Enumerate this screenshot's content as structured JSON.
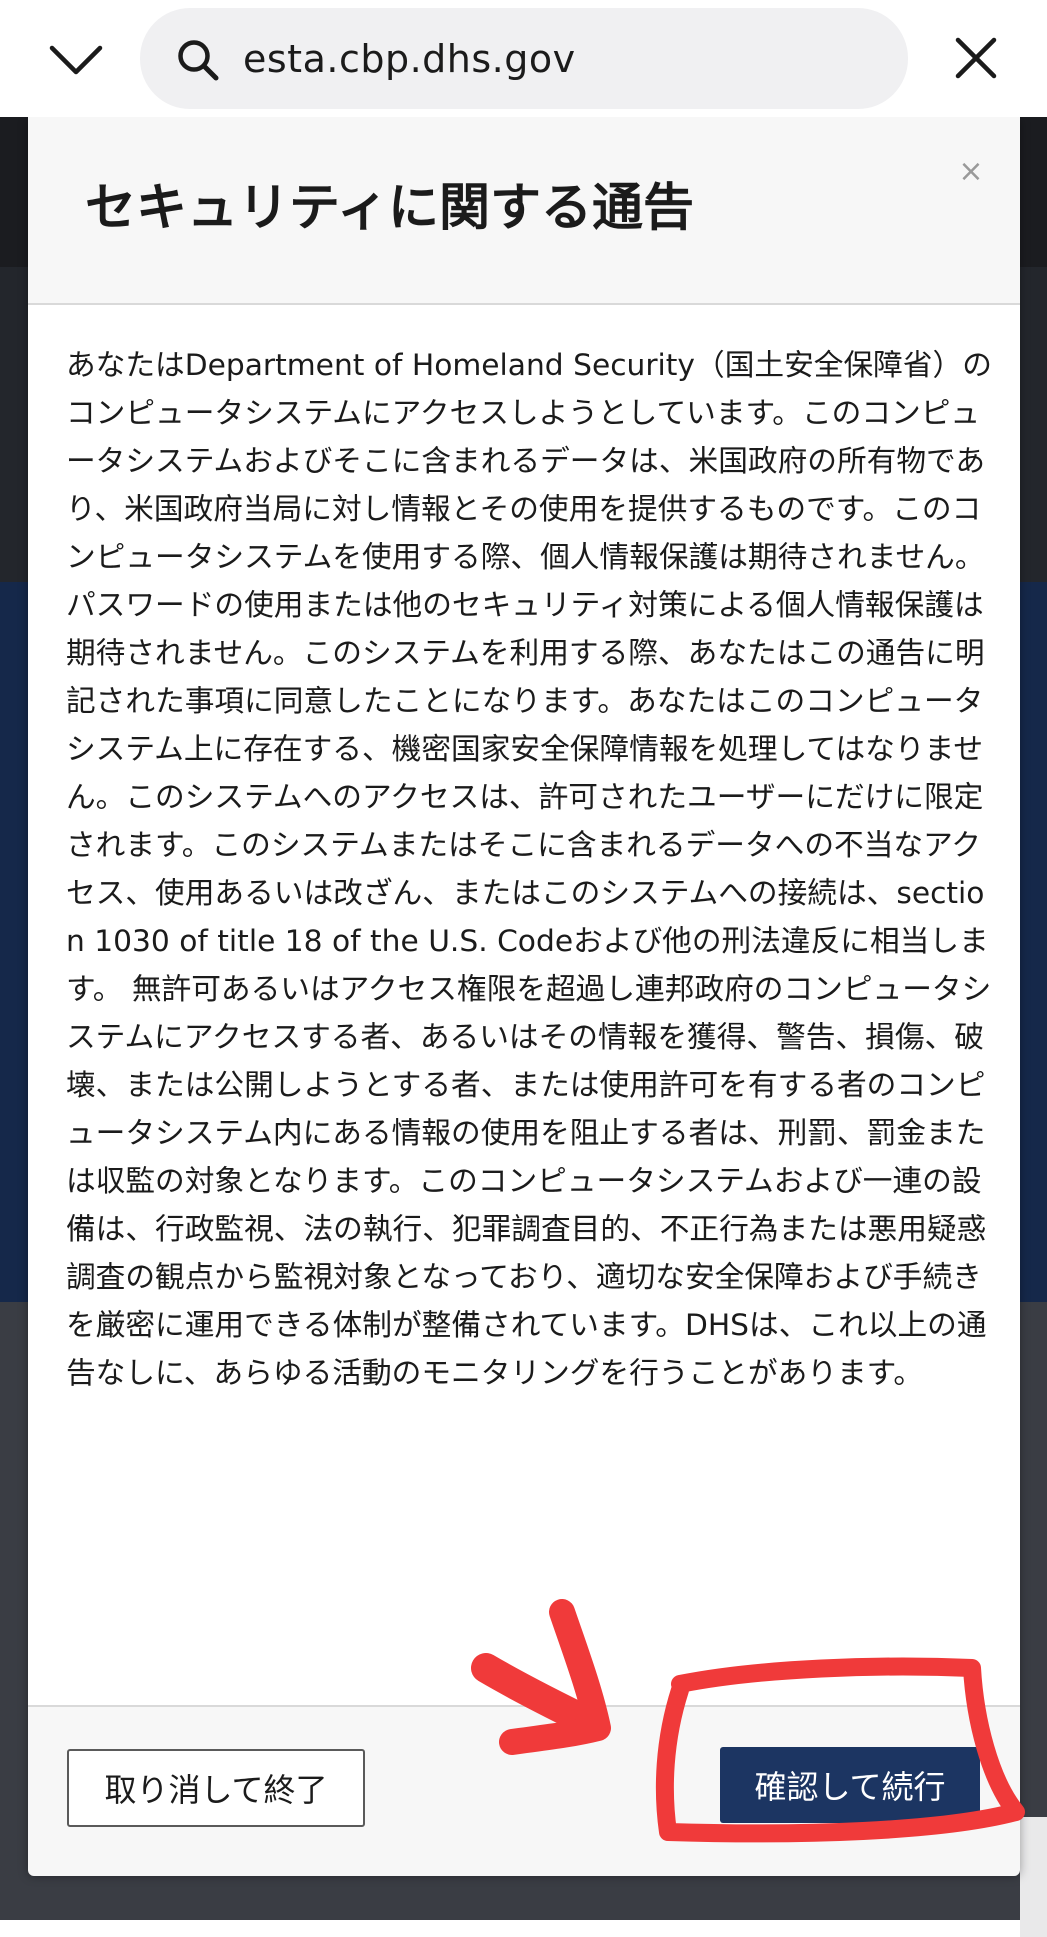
{
  "browser": {
    "url": "esta.cbp.dhs.gov",
    "collapse_icon": "chevron-down-icon",
    "search_icon": "search-icon",
    "close_icon": "close-icon"
  },
  "modal": {
    "title": "セキュリティに関する通告",
    "close_symbol": "×",
    "body": "あなたはDepartment of Homeland Security（国土安全保障省）のコンピュータシステムにアクセスしようとしています。このコンピュータシステムおよびそこに含まれるデータは、米国政府の所有物であり、米国政府当局に対し情報とその使用を提供するものです。このコンピュータシステムを使用する際、個人情報保護は期待されません。パスワードの使用または他のセキュリティ対策による個人情報保護は期待されません。このシステムを利用する際、あなたはこの通告に明記された事項に同意したことになります。あなたはこのコンピュータシステム上に存在する、機密国家安全保障情報を処理してはなりません。このシステムへのアクセスは、許可されたユーザーにだけに限定されます。このシステムまたはそこに含まれるデータへの不当なアクセス、使用あるいは改ざん、またはこのシステムへの接続は、section 1030 of title 18 of the U.S. Codeおよび他の刑法違反に相当します。 無許可あるいはアクセス権限を超過し連邦政府のコンピュータシステムにアクセスする者、あるいはその情報を獲得、警告、損傷、破壊、または公開しようとする者、または使用許可を有する者のコンピュータシステム内にある情報の使用を阻止する者は、刑罰、罰金または収監の対象となります。このコンピュータシステムおよび一連の設備は、行政監視、法の執行、犯罪調査目的、不正行為または悪用疑惑調査の観点から監視対象となっており、適切な安全保障および手続きを厳密に運用できる体制が整備されています。DHSは、これ以上の通告なしに、あらゆる活動のモニタリングを行うことがあります。",
    "cancel_button": "取り消して終了",
    "confirm_button": "確認して続行"
  },
  "colors": {
    "confirm_button_bg": "#1c3562",
    "annotation_red": "#f03a3a"
  }
}
